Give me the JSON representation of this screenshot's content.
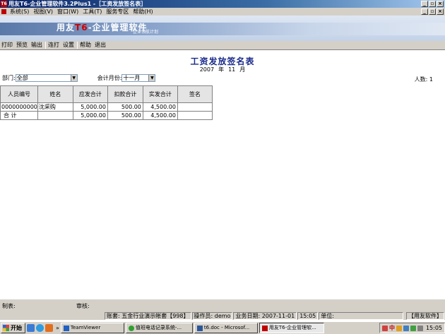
{
  "window": {
    "title": "用友T6-企业管理软件3.2Plus1  -［工资发放签名表］",
    "app_badge": "T6"
  },
  "menu": {
    "items": [
      "系统(S)",
      "视图(V)",
      "窗口(W)",
      "工具(T)",
      "服务专区",
      "帮助(H)"
    ]
  },
  "banner": {
    "logo_prefix": "用友",
    "logo_num": "T6",
    "logo_suffix": "-企业管理软件",
    "sub": "企业领航计划"
  },
  "toolbar": {
    "print": "打印",
    "preview": "预览",
    "export": "输出",
    "continuous": "连打",
    "settings": "设置",
    "help": "帮助",
    "exit": "退出"
  },
  "report": {
    "title": "工资发放签名表",
    "year": "2007",
    "year_unit": "年",
    "month": "11",
    "month_unit": "月",
    "dept_label": "部门:",
    "dept_value": "全部",
    "month_label": "会计月份:",
    "month_value": "十一月",
    "headcount": "人数: 1",
    "columns": [
      "人员编号",
      "姓名",
      "应发合计",
      "扣款合计",
      "实发合计",
      "签名"
    ],
    "rows": [
      [
        "0000000000",
        "沈采购",
        "5,000.00",
        "500.00",
        "4,500.00",
        ""
      ]
    ],
    "total": [
      "合 计",
      "",
      "5,000.00",
      "500.00",
      "4,500.00",
      ""
    ]
  },
  "footer": {
    "maker": "制表:",
    "reviewer": "审核:"
  },
  "status": {
    "account": "账套: 五金行业演示帐套【998】",
    "operator": "操作员: demo",
    "biz_date": "业务日期: 2007-11-01",
    "time": "15:05",
    "unit": "单位:",
    "brand": "【用友软件】"
  },
  "taskbar": {
    "start": "开始",
    "more": "»",
    "tasks": [
      "TeamViewer",
      "值班电话记录系统-...",
      "t6.doc - Microsof...",
      "用友T6-企业管理软..."
    ],
    "tray_char": "中",
    "clock": "15:05"
  }
}
